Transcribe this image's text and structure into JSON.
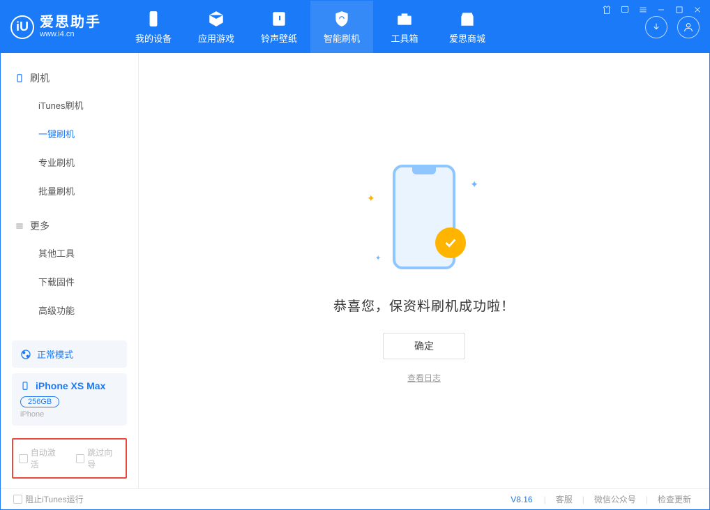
{
  "app": {
    "name": "爱思助手",
    "url": "www.i4.cn"
  },
  "nav": {
    "items": [
      {
        "label": "我的设备"
      },
      {
        "label": "应用游戏"
      },
      {
        "label": "铃声壁纸"
      },
      {
        "label": "智能刷机"
      },
      {
        "label": "工具箱"
      },
      {
        "label": "爱思商城"
      }
    ]
  },
  "sidebar": {
    "group1_title": "刷机",
    "group1_items": [
      "iTunes刷机",
      "一键刷机",
      "专业刷机",
      "批量刷机"
    ],
    "group2_title": "更多",
    "group2_items": [
      "其他工具",
      "下载固件",
      "高级功能"
    ],
    "mode_label": "正常模式",
    "device": {
      "name": "iPhone XS Max",
      "storage": "256GB",
      "type": "iPhone"
    },
    "checkbox1": "自动激活",
    "checkbox2": "跳过向导"
  },
  "main": {
    "success_text": "恭喜您，保资料刷机成功啦！",
    "ok_button": "确定",
    "view_log": "查看日志"
  },
  "footer": {
    "block_itunes": "阻止iTunes运行",
    "version": "V8.16",
    "links": [
      "客服",
      "微信公众号",
      "检查更新"
    ]
  }
}
